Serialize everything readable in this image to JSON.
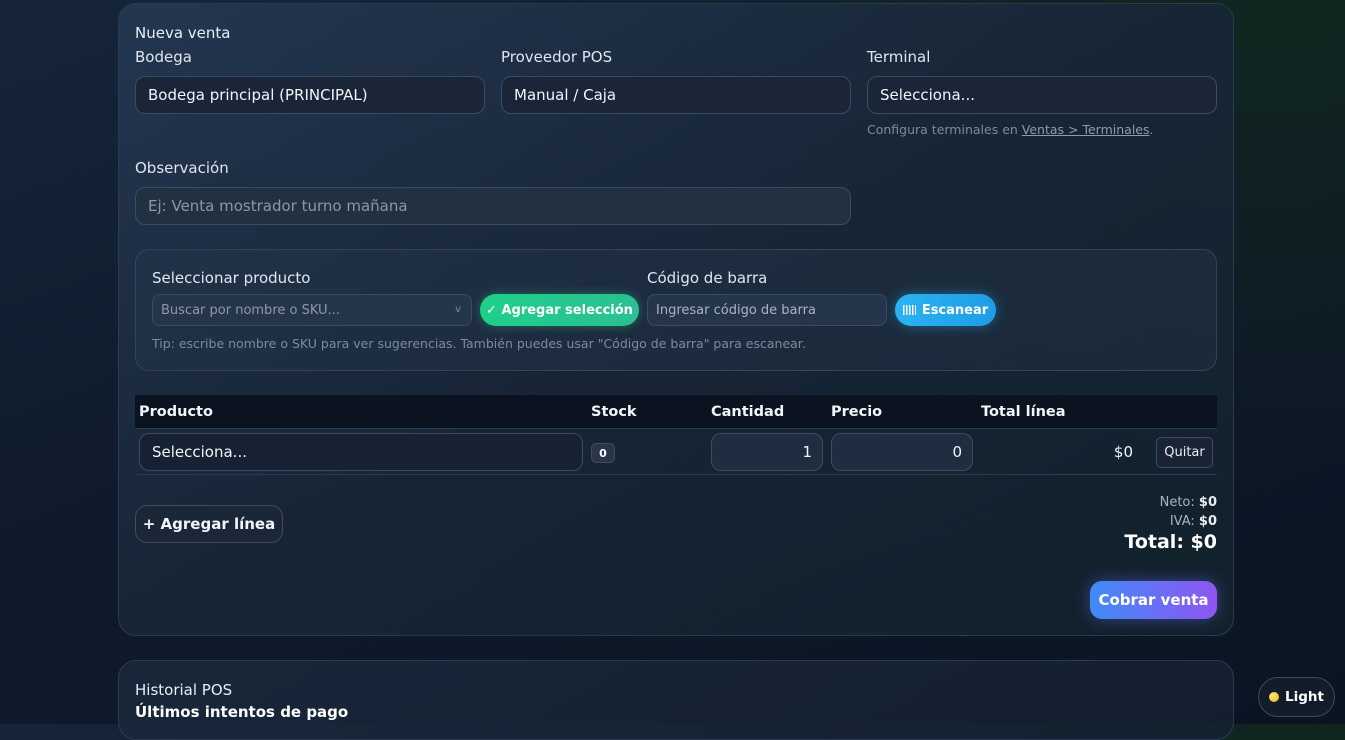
{
  "nueva_venta": {
    "title": "Nueva venta",
    "bodega": {
      "label": "Bodega",
      "value": "Bodega principal (PRINCIPAL)"
    },
    "proveedor": {
      "label": "Proveedor POS",
      "value": "Manual / Caja"
    },
    "terminal": {
      "label": "Terminal",
      "value": "Selecciona...",
      "help_prefix": "Configura terminales en ",
      "help_link": "Ventas > Terminales",
      "help_suffix": "."
    },
    "observacion": {
      "label": "Observación",
      "placeholder": "Ej: Venta mostrador turno mañana"
    },
    "producto_selector": {
      "label": "Seleccionar producto",
      "placeholder": "Buscar por nombre o SKU...",
      "add_label": "✓ Agregar selección",
      "barcode_label": "Código de barra",
      "barcode_placeholder": "Ingresar código de barra",
      "scan_label": "Escanear",
      "tip": "Tip: escribe nombre o SKU para ver sugerencias. También puedes usar \"Código de barra\" para escanear."
    },
    "table": {
      "headers": [
        "Producto",
        "Stock",
        "Cantidad",
        "Precio",
        "Total línea"
      ],
      "rows": [
        {
          "producto": "Selecciona...",
          "stock": "0",
          "cantidad": "1",
          "precio": "0",
          "total": "$0",
          "remove": "Quitar"
        }
      ]
    },
    "add_line": "+ Agregar línea",
    "totals": {
      "neto_label": "Neto:",
      "neto": "$0",
      "iva_label": "IVA:",
      "iva": "$0",
      "total_label": "Total:",
      "total": "$0"
    },
    "cobrar": "Cobrar venta"
  },
  "historial": {
    "title": "Historial POS",
    "subtitle": "Últimos intentos de pago"
  },
  "theme_toggle": {
    "label": "Light"
  },
  "colors": {
    "accent_green": "#1fcf8a",
    "accent_blue": "#2ab3f2",
    "cobrar_gradient_start": "#3f8cf7",
    "cobrar_gradient_end": "#8f55f3"
  }
}
